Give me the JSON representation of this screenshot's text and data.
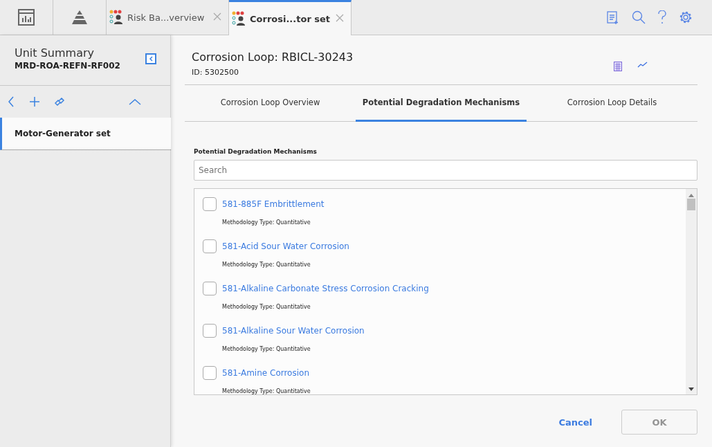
{
  "top_bar": {
    "doc_tabs": [
      {
        "label": "Risk Ba...verview",
        "selected": false
      },
      {
        "label": "Corrosi...tor set",
        "selected": true
      }
    ]
  },
  "sidebar": {
    "title": "Unit Summary",
    "subtitle": "MRD-ROA-REFN-RF002",
    "items": [
      {
        "label": "Motor-Generator set",
        "selected": true
      }
    ]
  },
  "record": {
    "title": "Corrosion Loop: RBICL-30243",
    "id": "ID: 5302500"
  },
  "tabs": [
    {
      "label": "Corrosion Loop Overview",
      "selected": false
    },
    {
      "label": "Potential Degradation Mechanisms",
      "selected": true
    },
    {
      "label": "Corrosion Loop Details",
      "selected": false
    }
  ],
  "section_label": "Potential Degradation Mechanisms",
  "search": {
    "placeholder": "Search"
  },
  "mechanisms": [
    {
      "name": "581-885F Embrittlement",
      "detail": "Methodology Type: Quantitative",
      "checked": false
    },
    {
      "name": "581-Acid Sour Water Corrosion",
      "detail": "Methodology Type: Quantitative",
      "checked": false
    },
    {
      "name": "581-Alkaline Carbonate Stress Corrosion Cracking",
      "detail": "Methodology Type: Quantitative",
      "checked": false
    },
    {
      "name": "581-Alkaline Sour Water Corrosion",
      "detail": "Methodology Type: Quantitative",
      "checked": false
    },
    {
      "name": "581-Amine Corrosion",
      "detail": "Methodology Type: Quantitative",
      "checked": false
    }
  ],
  "buttons": [
    {
      "label": "Cancel",
      "disabled": false
    },
    {
      "label": "OK",
      "disabled": true
    }
  ]
}
